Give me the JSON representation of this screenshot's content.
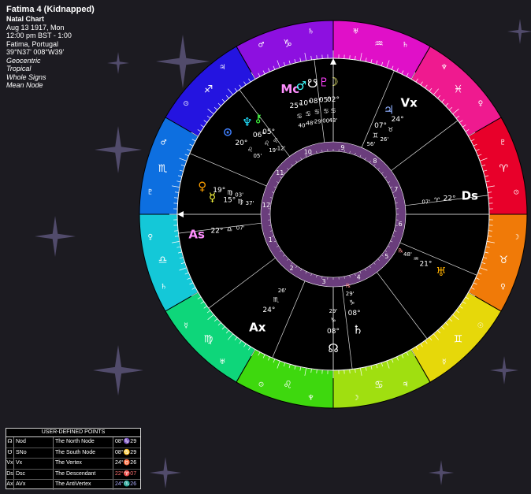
{
  "header": {
    "title": "Fatima 4 (Kidnapped)",
    "chart_type": "Natal Chart",
    "date": "Aug 13 1917, Mon",
    "time": "12:00 pm  BST - 1:00",
    "place": "Fatima, Portugal",
    "coords": "39°N37' 008°W39'",
    "options": [
      "Geocentric",
      "Tropical",
      "Whole Signs",
      "Mean Node"
    ]
  },
  "user_points": {
    "title": "USER-DEFINED POINTS",
    "rows": [
      {
        "glyph": "☊",
        "short": "Nod",
        "name": "The North Node",
        "pos": "08°♑29",
        "color": "#ffffff"
      },
      {
        "glyph": "☋",
        "short": "SNo",
        "name": "The South Node",
        "pos": "08°♋29",
        "color": "#ffffff"
      },
      {
        "glyph": "Vx",
        "short": "Vx",
        "name": "The Vertex",
        "pos": "24°♉26",
        "color": "#ffffff"
      },
      {
        "glyph": "Ds",
        "short": "Dsc",
        "name": "The Descendant",
        "pos": "22°♈07",
        "color": "#ff7070"
      },
      {
        "glyph": "Ax",
        "short": "AVx",
        "name": "The AntiVertex",
        "pos": "24°♏26",
        "color": "#b0b0ff"
      }
    ]
  },
  "chart": {
    "signs": [
      {
        "glyph": "♈",
        "color": "#e8002a",
        "sub": [
          "⊙",
          "♇"
        ],
        "label_color": "#ffffff"
      },
      {
        "glyph": "♓",
        "color": "#ef1a8f",
        "sub": [
          "♀",
          "♆"
        ],
        "label_color": "#ffffff"
      },
      {
        "glyph": "♒",
        "color": "#e010c8",
        "sub": [
          "♄",
          "♅"
        ],
        "label_color": "#ffffff"
      },
      {
        "glyph": "♑",
        "color": "#8d10e0",
        "sub": [
          "♄",
          "♂"
        ],
        "label_color": "#ffffff"
      },
      {
        "glyph": "♐",
        "color": "#2414e0",
        "sub": [
          "♃",
          "⊙"
        ],
        "label_color": "#ffffff"
      },
      {
        "glyph": "♏",
        "color": "#0d6fe0",
        "sub": [
          "♂",
          "♇"
        ],
        "label_color": "#ffffff"
      },
      {
        "glyph": "♎",
        "color": "#14c8d8",
        "sub": [
          "♀",
          "♄"
        ],
        "label_color": "#ffffff"
      },
      {
        "glyph": "♍",
        "color": "#0ed67a",
        "sub": [
          "☿",
          "♅"
        ],
        "label_color": "#ffffff"
      },
      {
        "glyph": "♌",
        "color": "#3ed80e",
        "sub": [
          "⊙",
          "♆"
        ],
        "label_color": "#ffffff"
      },
      {
        "glyph": "♋",
        "color": "#a0df10",
        "sub": [
          "☽",
          "♃"
        ],
        "label_color": "#ffffff"
      },
      {
        "glyph": "♊",
        "color": "#e6d80a",
        "sub": [
          "☿",
          "☉"
        ],
        "label_color": "#ffffff"
      },
      {
        "glyph": "♉",
        "color": "#f07a08",
        "sub": [
          "♀",
          "☽"
        ],
        "label_color": "#ffffff"
      }
    ],
    "houses": [
      "1",
      "2",
      "3",
      "4",
      "5",
      "6",
      "7",
      "8",
      "9",
      "10",
      "11",
      "12"
    ],
    "angles": [
      {
        "glyph": "As",
        "deg": "22°",
        "sign": "♎",
        "min": "07'",
        "color": "#ff8fff"
      },
      {
        "glyph": "Ds",
        "deg": "22°",
        "sign": "♈",
        "min": "07'",
        "color": "#ffffff"
      },
      {
        "glyph": "Vx",
        "deg": "24°",
        "sign": "♉",
        "min": "26'",
        "color": "#ffffff"
      },
      {
        "glyph": "Ax",
        "deg": "24°",
        "sign": "♏",
        "min": "26'",
        "color": "#ffffff"
      }
    ],
    "planets": [
      {
        "glyph": "♃",
        "deg": "07°",
        "sign": "♊",
        "min": "56'",
        "color": "#8fb0ff"
      },
      {
        "glyph": "♅",
        "deg": "21°",
        "sign": "♒",
        "min": "48'",
        "color": "#ffb000",
        "retro": "℞"
      },
      {
        "glyph": "♄",
        "deg": "08°",
        "sign": "♑",
        "min": "29'",
        "color": "#ffffff",
        "retro": "℞"
      },
      {
        "glyph": "☊",
        "deg": "08°",
        "sign": "♑",
        "min": "29'",
        "color": "#ffffff"
      },
      {
        "glyph": "☿",
        "deg": "15°",
        "sign": "♍",
        "min": "37'",
        "color": "#ffff40"
      },
      {
        "glyph": "♀",
        "deg": "19°",
        "sign": "♍",
        "min": "03'",
        "color": "#ffa000"
      },
      {
        "glyph": "⊙",
        "deg": "20°",
        "sign": "♌",
        "min": "05'",
        "color": "#4080ff"
      },
      {
        "glyph": "♆",
        "deg": "06°",
        "sign": "♌",
        "min": "19'",
        "color": "#20e0ff"
      },
      {
        "glyph": "⚷",
        "deg": "05°",
        "sign": "♌",
        "min": "12'",
        "color": "#40ff40"
      },
      {
        "glyph": "Mc",
        "deg": "25°",
        "sign": "♋",
        "min": "40'",
        "color": "#ff8fff"
      },
      {
        "glyph": "♂",
        "deg": "10°",
        "sign": "♋",
        "min": "48'",
        "color": "#40ffff"
      },
      {
        "glyph": "☋",
        "deg": "08°",
        "sign": "♋",
        "min": "29'",
        "color": "#ffffff"
      },
      {
        "glyph": "♇",
        "deg": "05°",
        "sign": "♋",
        "min": "00'",
        "color": "#ff40ff"
      },
      {
        "glyph": "☽",
        "deg": "02°",
        "sign": "♋",
        "min": "43'",
        "color": "#ffff80"
      }
    ],
    "retrograde_mark": "℞"
  }
}
